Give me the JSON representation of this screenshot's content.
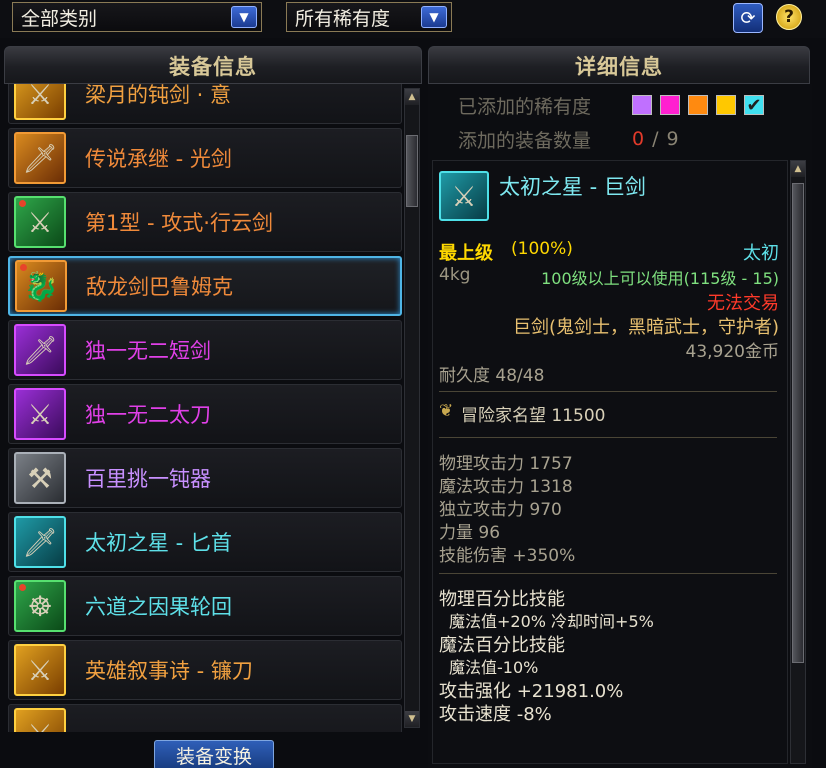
{
  "filters": {
    "category": "全部类别",
    "rarity": "所有稀有度"
  },
  "header": {
    "left_title": "装备信息",
    "right_title": "详细信息"
  },
  "items": [
    {
      "name": "梁月的钝剑 · 意",
      "color": "#f0a040",
      "frame": "frame-epic",
      "glyph": "⚔"
    },
    {
      "name": "传说承继 - 光剑",
      "color": "#f08a3a",
      "frame": "frame-legend",
      "glyph": "🗡"
    },
    {
      "name": "第1型 - 攻式·行云剑",
      "color": "#f08a3a",
      "frame": "frame-green",
      "glyph": "⚔",
      "dot": true
    },
    {
      "name": "敌龙剑巴鲁姆克",
      "color": "#f08a3a",
      "frame": "frame-legend",
      "glyph": "🐉",
      "dot": true,
      "selected": true
    },
    {
      "name": "独一无二短剑",
      "color": "#e040e8",
      "frame": "frame-purple",
      "glyph": "🗡"
    },
    {
      "name": "独一无二太刀",
      "color": "#e040e8",
      "frame": "frame-purple",
      "glyph": "⚔"
    },
    {
      "name": "百里挑一钝器",
      "color": "#c890ff",
      "frame": "frame-grey",
      "glyph": "⚒"
    },
    {
      "name": "太初之星 - 匕首",
      "color": "#5ee0e8",
      "frame": "frame-cyan",
      "glyph": "🗡"
    },
    {
      "name": "六道之因果轮回",
      "color": "#5ee0e8",
      "frame": "frame-green",
      "glyph": "☸",
      "dot": true
    },
    {
      "name": "英雄叙事诗 - 镰刀",
      "color": "#f0a040",
      "frame": "frame-epic",
      "glyph": "⚔"
    },
    {
      "name": "",
      "color": "#f0a040",
      "frame": "frame-epic",
      "glyph": "⚔"
    }
  ],
  "convert_button": "装备变换",
  "rarity_filter": {
    "label": "已添加的稀有度",
    "colors": [
      "#c070ff",
      "#ff20d0",
      "#ff8a10",
      "#ffc800",
      "#40e0f0"
    ]
  },
  "count": {
    "label": "添加的装备数量",
    "current": "0",
    "separator": "/",
    "max": "9"
  },
  "detail": {
    "title": "太初之星 - 巨剑",
    "grade": "最上级",
    "grade_pct": "(100%)",
    "rarity_name": "太初",
    "weight": "4kg",
    "level_req": "100级以上可以使用(115级 - 15)",
    "trade": "无法交易",
    "classes": "巨剑(鬼剑士，黑暗武士，守护者)",
    "price": "43,920金币",
    "durability": "耐久度 48/48",
    "fame": "冒险家名望 11500",
    "stats": [
      "物理攻击力 1757",
      "魔法攻击力 1318",
      "独立攻击力 970",
      "力量 96",
      "技能伤害 +350%"
    ],
    "effects": [
      {
        "text": "物理百分比技能",
        "indent": false
      },
      {
        "text": "魔法值+20% 冷却时间+5%",
        "indent": true
      },
      {
        "text": "魔法百分比技能",
        "indent": false
      },
      {
        "text": "魔法值-10%",
        "indent": true
      },
      {
        "text": "攻击强化 +21981.0%",
        "indent": false
      },
      {
        "text": "攻击速度 -8%",
        "indent": false
      }
    ]
  },
  "colors": {
    "selection": "#4fb5e6",
    "grade": "#ffd800",
    "rarity_cyan": "#5ee0e8",
    "level_req": "#7fe07f",
    "trade": "#ff3a2a",
    "classes": "#e8c070"
  }
}
